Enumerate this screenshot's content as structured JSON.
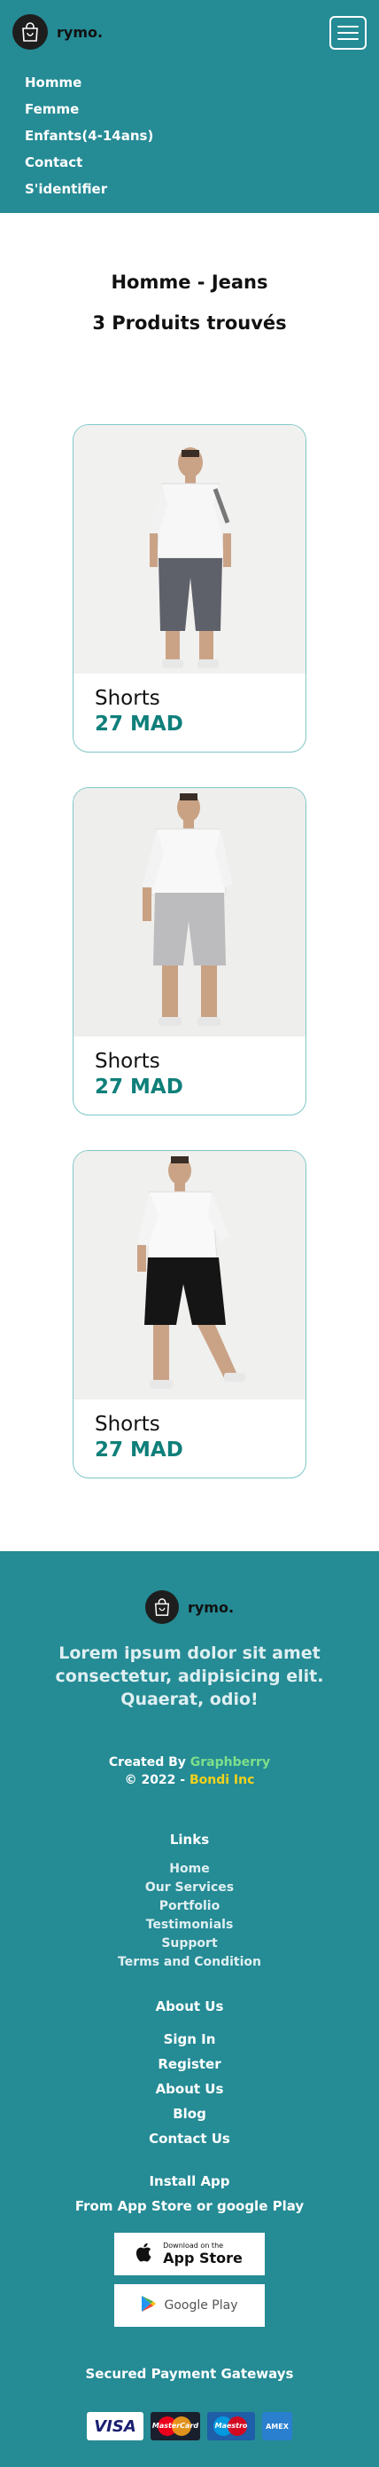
{
  "header": {
    "brand": "rymo.",
    "nav": [
      "Homme",
      "Femme",
      "Enfants(4-14ans)",
      "Contact",
      "S'identifier"
    ]
  },
  "main": {
    "title": "Homme - Jeans",
    "result_count": "3 Produits trouvés",
    "products": [
      {
        "name": "Shorts",
        "price": "27 MAD",
        "variant": "gray capri shorts"
      },
      {
        "name": "Shorts",
        "price": "27 MAD",
        "variant": "light gray shorts"
      },
      {
        "name": "Shorts",
        "price": "27 MAD",
        "variant": "black shorts"
      }
    ]
  },
  "footer": {
    "brand": "rymo.",
    "tagline": "Lorem ipsum dolor sit amet consectetur, adipisicing elit. Quaerat, odio!",
    "created_by_prefix": "Created By ",
    "created_by_name": "Graphberry",
    "copyright_prefix": "© 2022 - ",
    "copyright_name": "Bondi Inc",
    "links_title": "Links",
    "links": [
      "Home",
      "Our Services",
      "Portfolio",
      "Testimonials",
      "Support",
      "Terms and Condition"
    ],
    "about_title": "About Us",
    "about_links": [
      "Sign In",
      "Register",
      "About Us",
      "Blog",
      "Contact Us"
    ],
    "install_title": "Install App",
    "install_subtitle": "From App Store or google Play",
    "app_store_small": "Download on the",
    "app_store_big": "App Store",
    "google_play": "Google Play",
    "payment_title": "Secured Payment Gateways",
    "payments": {
      "visa": "VISA",
      "mastercard": "MasterCard",
      "maestro": "Maestro",
      "amex": "AMEX"
    }
  },
  "colors": {
    "brand_teal": "#258b95",
    "price_green": "#0f7f7a",
    "credit_green": "#7ee08a",
    "credit_yellow": "#f2d21a"
  },
  "icons": {
    "logo": "shopping-bag-icon",
    "menu": "hamburger-icon",
    "apple": "apple-icon",
    "google_play": "google-play-icon"
  }
}
